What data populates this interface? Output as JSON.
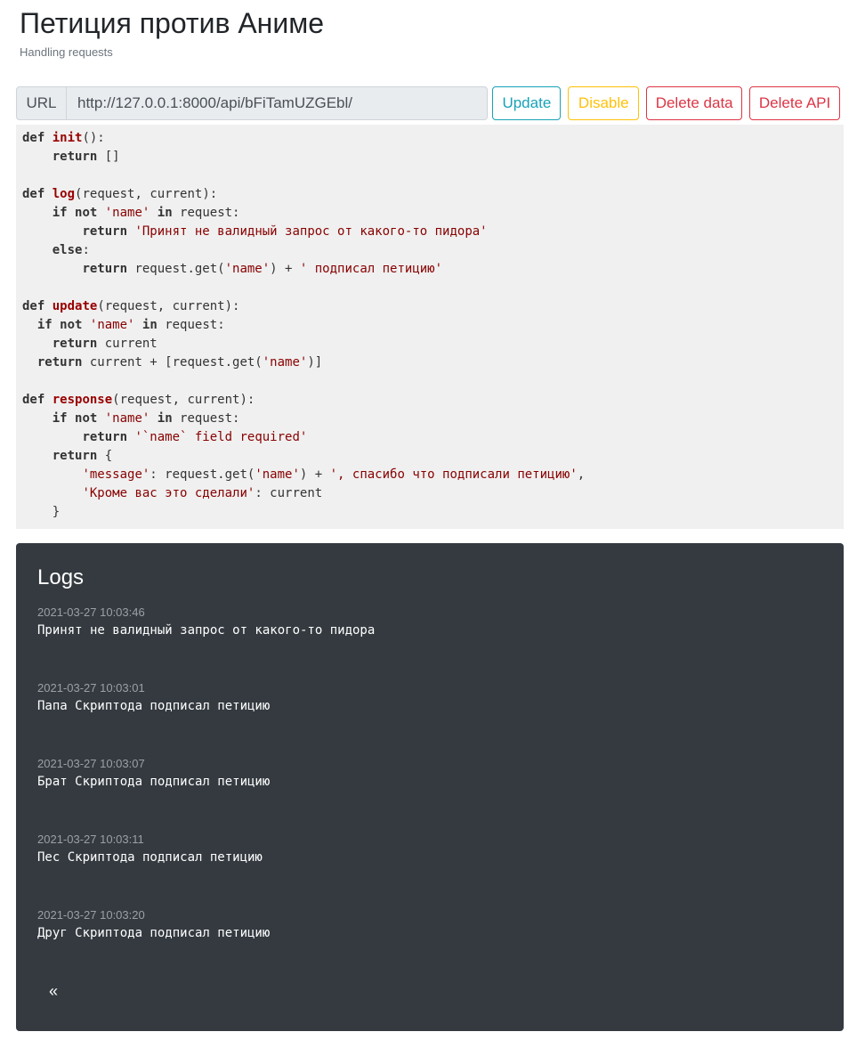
{
  "header": {
    "title": "Петиция против Аниме",
    "subtitle": "Handling requests"
  },
  "toolbar": {
    "url_label": "URL",
    "url_value": "http://127.0.0.1:8000/api/bFiTamUZGEbl/",
    "update_label": "Update",
    "disable_label": "Disable",
    "delete_data_label": "Delete data",
    "delete_api_label": "Delete API"
  },
  "code": [
    [
      [
        "kw",
        "def"
      ],
      [
        "t",
        " "
      ],
      [
        "fn",
        "init"
      ],
      [
        "t",
        "():"
      ]
    ],
    [
      [
        "t",
        "    "
      ],
      [
        "kw",
        "return"
      ],
      [
        "t",
        " []"
      ]
    ],
    [],
    [
      [
        "kw",
        "def"
      ],
      [
        "t",
        " "
      ],
      [
        "fn",
        "log"
      ],
      [
        "t",
        "(request, current):"
      ]
    ],
    [
      [
        "t",
        "    "
      ],
      [
        "kw",
        "if"
      ],
      [
        "t",
        " "
      ],
      [
        "kw",
        "not"
      ],
      [
        "t",
        " "
      ],
      [
        "str",
        "'name'"
      ],
      [
        "t",
        " "
      ],
      [
        "kw",
        "in"
      ],
      [
        "t",
        " request:"
      ]
    ],
    [
      [
        "t",
        "        "
      ],
      [
        "kw",
        "return"
      ],
      [
        "t",
        " "
      ],
      [
        "str",
        "'Принят не валидный запрос от какого-то пидора'"
      ]
    ],
    [
      [
        "t",
        "    "
      ],
      [
        "kw",
        "else"
      ],
      [
        "t",
        ":"
      ]
    ],
    [
      [
        "t",
        "        "
      ],
      [
        "kw",
        "return"
      ],
      [
        "t",
        " request.get("
      ],
      [
        "str",
        "'name'"
      ],
      [
        "t",
        ") + "
      ],
      [
        "str",
        "' подписал петицию'"
      ]
    ],
    [],
    [
      [
        "kw",
        "def"
      ],
      [
        "t",
        " "
      ],
      [
        "fn",
        "update"
      ],
      [
        "t",
        "(request, current):"
      ]
    ],
    [
      [
        "t",
        "  "
      ],
      [
        "kw",
        "if"
      ],
      [
        "t",
        " "
      ],
      [
        "kw",
        "not"
      ],
      [
        "t",
        " "
      ],
      [
        "str",
        "'name'"
      ],
      [
        "t",
        " "
      ],
      [
        "kw",
        "in"
      ],
      [
        "t",
        " request:"
      ]
    ],
    [
      [
        "t",
        "    "
      ],
      [
        "kw",
        "return"
      ],
      [
        "t",
        " current"
      ]
    ],
    [
      [
        "t",
        "  "
      ],
      [
        "kw",
        "return"
      ],
      [
        "t",
        " current + [request.get("
      ],
      [
        "str",
        "'name'"
      ],
      [
        "t",
        ")]"
      ]
    ],
    [],
    [
      [
        "kw",
        "def"
      ],
      [
        "t",
        " "
      ],
      [
        "fn",
        "response"
      ],
      [
        "t",
        "(request, current):"
      ]
    ],
    [
      [
        "t",
        "    "
      ],
      [
        "kw",
        "if"
      ],
      [
        "t",
        " "
      ],
      [
        "kw",
        "not"
      ],
      [
        "t",
        " "
      ],
      [
        "str",
        "'name'"
      ],
      [
        "t",
        " "
      ],
      [
        "kw",
        "in"
      ],
      [
        "t",
        " request:"
      ]
    ],
    [
      [
        "t",
        "        "
      ],
      [
        "kw",
        "return"
      ],
      [
        "t",
        " "
      ],
      [
        "str",
        "'`name` field required'"
      ]
    ],
    [
      [
        "t",
        "    "
      ],
      [
        "kw",
        "return"
      ],
      [
        "t",
        " {"
      ]
    ],
    [
      [
        "t",
        "        "
      ],
      [
        "str",
        "'message'"
      ],
      [
        "t",
        ": request.get("
      ],
      [
        "str",
        "'name'"
      ],
      [
        "t",
        ") + "
      ],
      [
        "str",
        "', спасибо что подписали петицию'"
      ],
      [
        "t",
        ","
      ]
    ],
    [
      [
        "t",
        "        "
      ],
      [
        "str",
        "'Кроме вас это сделали'"
      ],
      [
        "t",
        ": current"
      ]
    ],
    [
      [
        "t",
        "    }"
      ]
    ]
  ],
  "logs": {
    "title": "Logs",
    "entries": [
      {
        "time": "2021-03-27 10:03:46",
        "message": "Принят не валидный запрос от какого-то пидора"
      },
      {
        "time": "2021-03-27 10:03:01",
        "message": "Папа Скриптода подписал петицию"
      },
      {
        "time": "2021-03-27 10:03:07",
        "message": "Брат Скриптода подписал петицию"
      },
      {
        "time": "2021-03-27 10:03:11",
        "message": "Пес Скриптода подписал петицию"
      },
      {
        "time": "2021-03-27 10:03:20",
        "message": "Друг Скриптода подписал петицию"
      }
    ],
    "pager_prev": "«"
  },
  "colors": {
    "info": "#17a2b8",
    "warning": "#ffc107",
    "danger": "#dc3545",
    "logs_bg": "#343a40",
    "code_bg": "#f0f0f0",
    "code_keyword_fn": "#990000",
    "code_string": "#880000"
  }
}
